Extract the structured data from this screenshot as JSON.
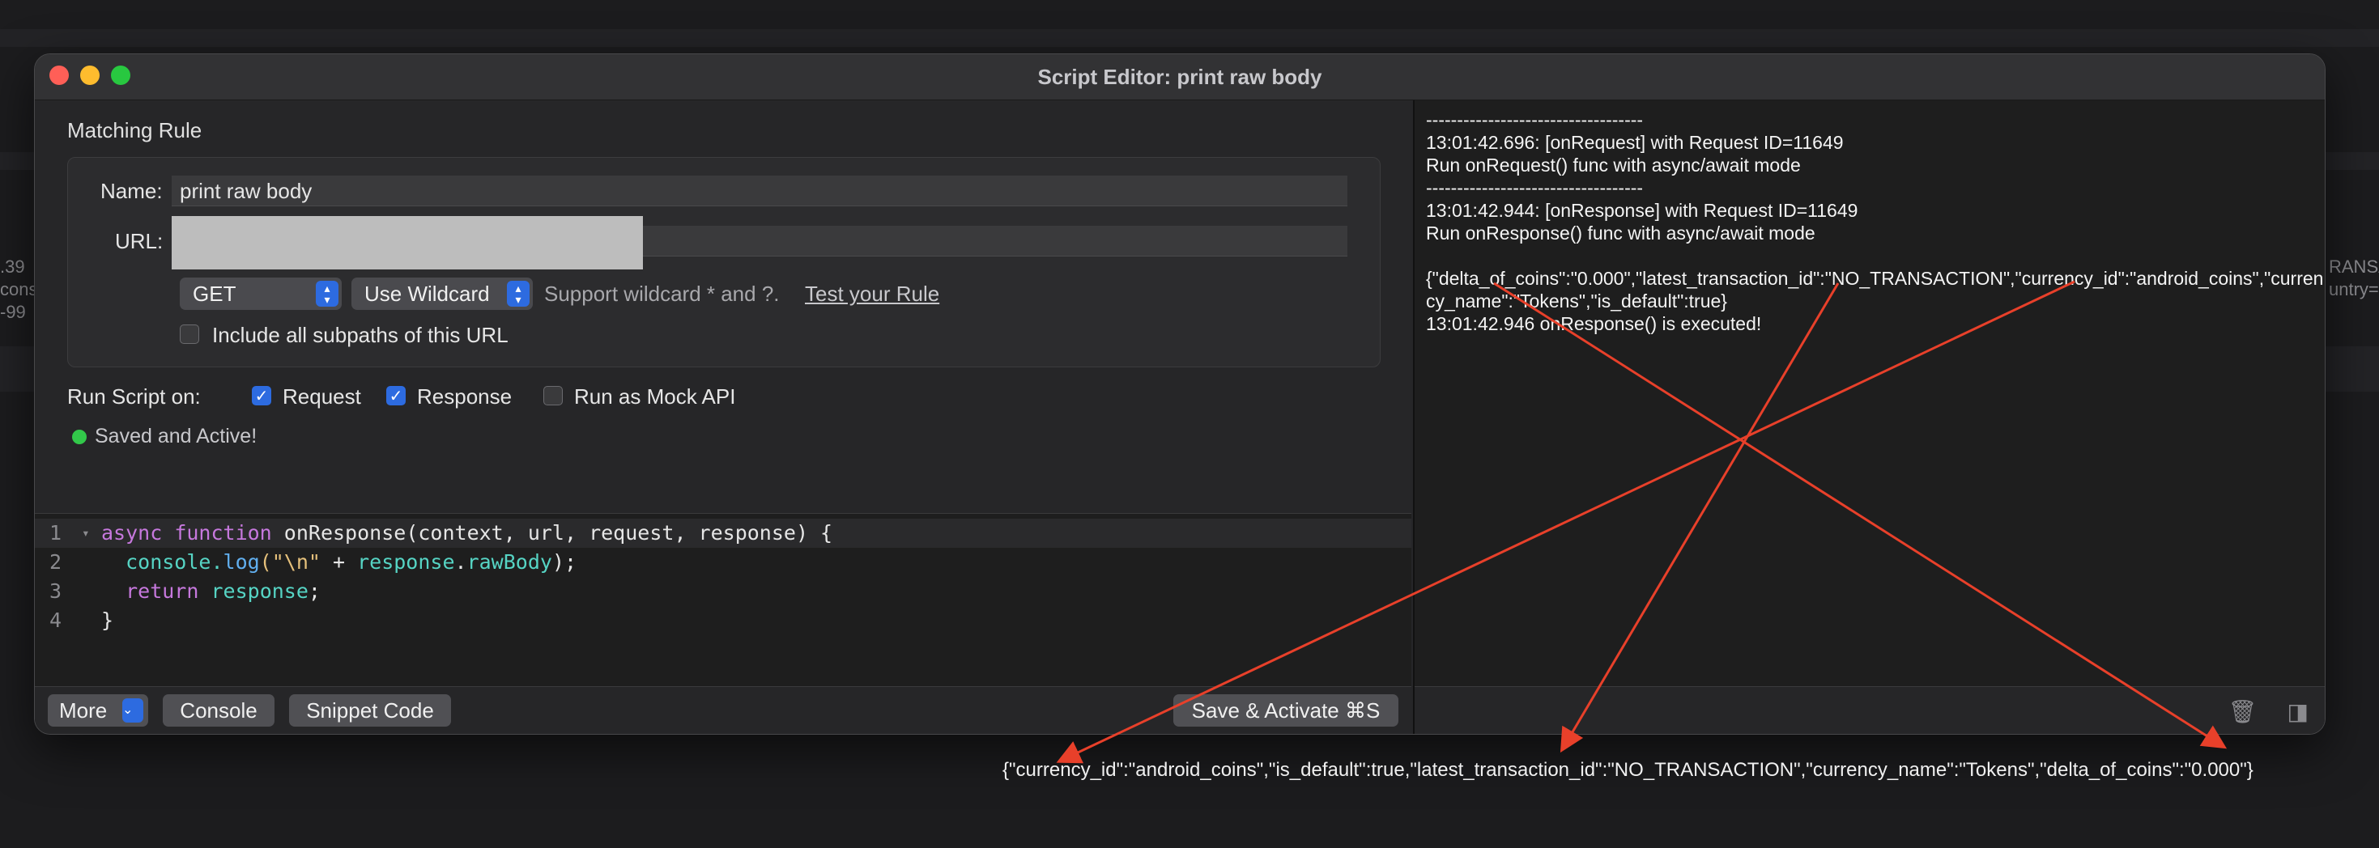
{
  "window": {
    "title": "Script Editor: print raw body"
  },
  "background": {
    "left_fragments": [
      ".39",
      "cons",
      "-99"
    ],
    "right_fragments": [
      "RANSA",
      "untry="
    ]
  },
  "rule": {
    "section_title": "Matching Rule",
    "name_label": "Name:",
    "name_value": "print raw body",
    "url_label": "URL:",
    "method": "GET",
    "match_mode": "Use Wildcard",
    "wildcard_hint": "Support wildcard * and ?.",
    "test_link": "Test your Rule",
    "subpaths_label": "Include all subpaths of this URL"
  },
  "run_on": {
    "label": "Run Script on:",
    "request_label": "Request",
    "response_label": "Response",
    "mock_label": "Run as Mock API"
  },
  "status": {
    "text": "Saved and Active!"
  },
  "code_lines": [
    {
      "num": "1",
      "parts": {
        "a": "async",
        "b": " ",
        "c": "function",
        "d": " onResponse(context, url, request, response) {"
      }
    },
    {
      "num": "2",
      "parts": {
        "a": "  console.",
        "b": "log",
        "c": "(\"\\n\"",
        "d": " + ",
        "e": "response",
        "f": ".",
        "g": "rawBody",
        "h": ");"
      }
    },
    {
      "num": "3",
      "parts": {
        "a": "  return",
        "b": " ",
        "c": "response",
        "d": ";"
      }
    },
    {
      "num": "4",
      "parts": {
        "a": "}"
      }
    }
  ],
  "buttons": {
    "more": "More",
    "console": "Console",
    "snippet": "Snippet Code",
    "save": "Save & Activate ⌘S"
  },
  "console": {
    "lines": [
      "-----------------------------------",
      "13:01:42.696: [onRequest] with Request ID=11649",
      "Run onRequest() func with async/await mode",
      "-----------------------------------",
      "13:01:42.944: [onResponse] with Request ID=11649",
      "Run onResponse() func with async/await mode",
      "",
      "{\"delta_of_coins\":\"0.000\",\"latest_transaction_id\":\"NO_TRANSACTION\",\"currency_id\":\"android_coins\",\"currency_name\":\"Tokens\",\"is_default\":true}",
      "13:01:42.946 onResponse() is executed!"
    ]
  },
  "below_output": "{\"currency_id\":\"android_coins\",\"is_default\":true,\"latest_transaction_id\":\"NO_TRANSACTION\",\"currency_name\":\"Tokens\",\"delta_of_coins\":\"0.000\"}",
  "colors": {
    "accent": "#2d6be0",
    "annotation": "#e8402a",
    "active_green": "#32c84a"
  }
}
